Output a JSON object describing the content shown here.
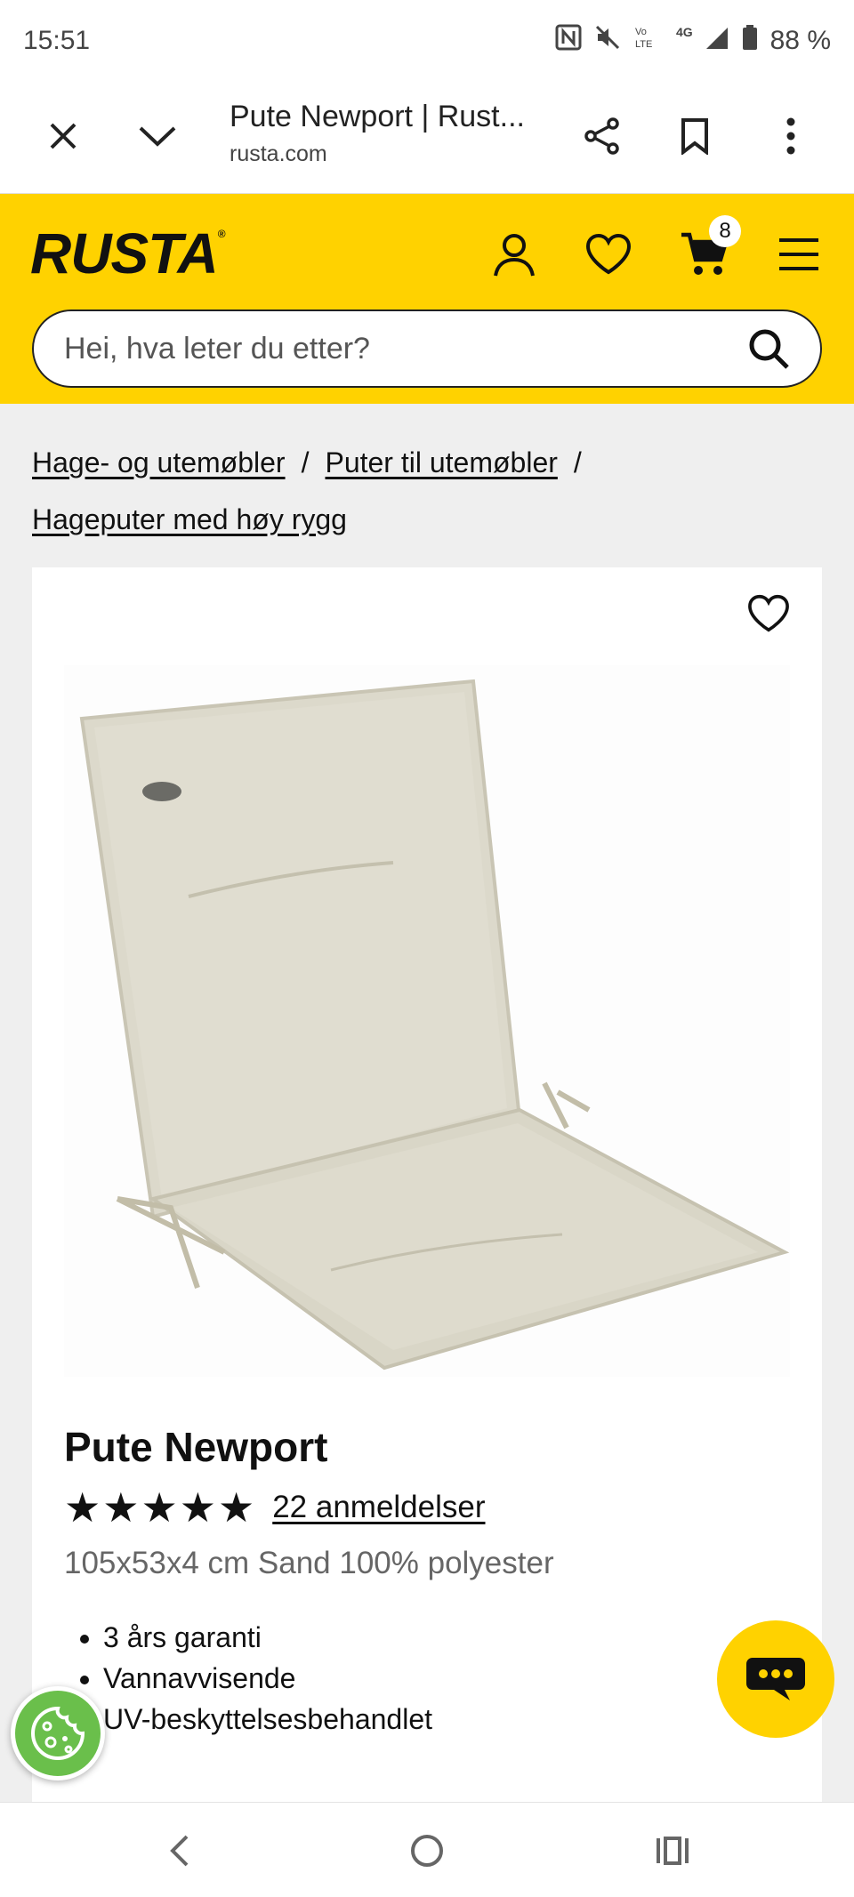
{
  "status_bar": {
    "time": "15:51",
    "battery": "88 %"
  },
  "browser": {
    "title": "Pute Newport | Rust...",
    "url": "rusta.com"
  },
  "header": {
    "logo": "RUSTA",
    "logo_mark": "®",
    "cart_count": "8",
    "search_placeholder": "Hei, hva leter du etter?",
    "brand_color": "#ffd200"
  },
  "breadcrumb": [
    "Hage- og utemøbler",
    "Puter til utemøbler",
    "Hageputer med høy rygg"
  ],
  "breadcrumb_sep": "/",
  "product": {
    "title": "Pute Newport",
    "stars": "★★★★★",
    "rating": 4.8,
    "reviews": "22 anmeldelser",
    "description": "105x53x4 cm Sand 100% polyester",
    "features": [
      "3 års garanti",
      "Vannavvisende",
      "UV-beskyttelsesbehandlet"
    ]
  }
}
